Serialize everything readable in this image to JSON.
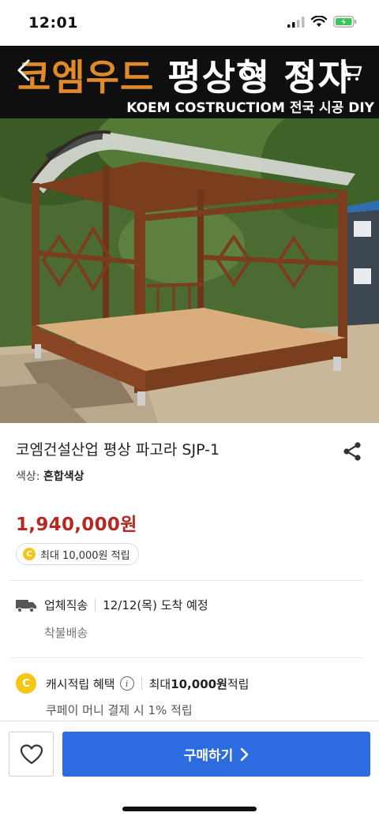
{
  "status_bar": {
    "time": "12:01"
  },
  "hero": {
    "banner_title_orange": "코엠우드",
    "banner_title_white": "평상형 정자",
    "banner_subtitle": "KOEM COSTRUCTIOM  전국 시공 DIY"
  },
  "product": {
    "title": "코엠건설산업 평상 파고라 SJP-1",
    "option_label": "색상: ",
    "option_value": "혼합색상",
    "price": "1,940,000원",
    "reward_badge": "최대 10,000원 적립"
  },
  "shipping": {
    "method": "업체직송",
    "arrival": "12/12(목) 도착 예정",
    "fee": "착불배송"
  },
  "cash_reward": {
    "label": "캐시적립 혜택",
    "max_prefix": "최대 ",
    "max_amount": "10,000원",
    "max_suffix": " 적립",
    "sub": "쿠페이 머니 결제 시 1% 적립"
  },
  "bottom_bar": {
    "buy_label": "구매하기"
  },
  "colors": {
    "price": "#b42a22",
    "buy_button": "#2c6be0",
    "coin": "#f5c518"
  },
  "icons": [
    "back-arrow-icon",
    "search-icon",
    "home-icon",
    "cart-icon",
    "share-icon",
    "truck-icon",
    "coin-icon",
    "info-icon",
    "heart-icon",
    "chevron-right-icon"
  ]
}
